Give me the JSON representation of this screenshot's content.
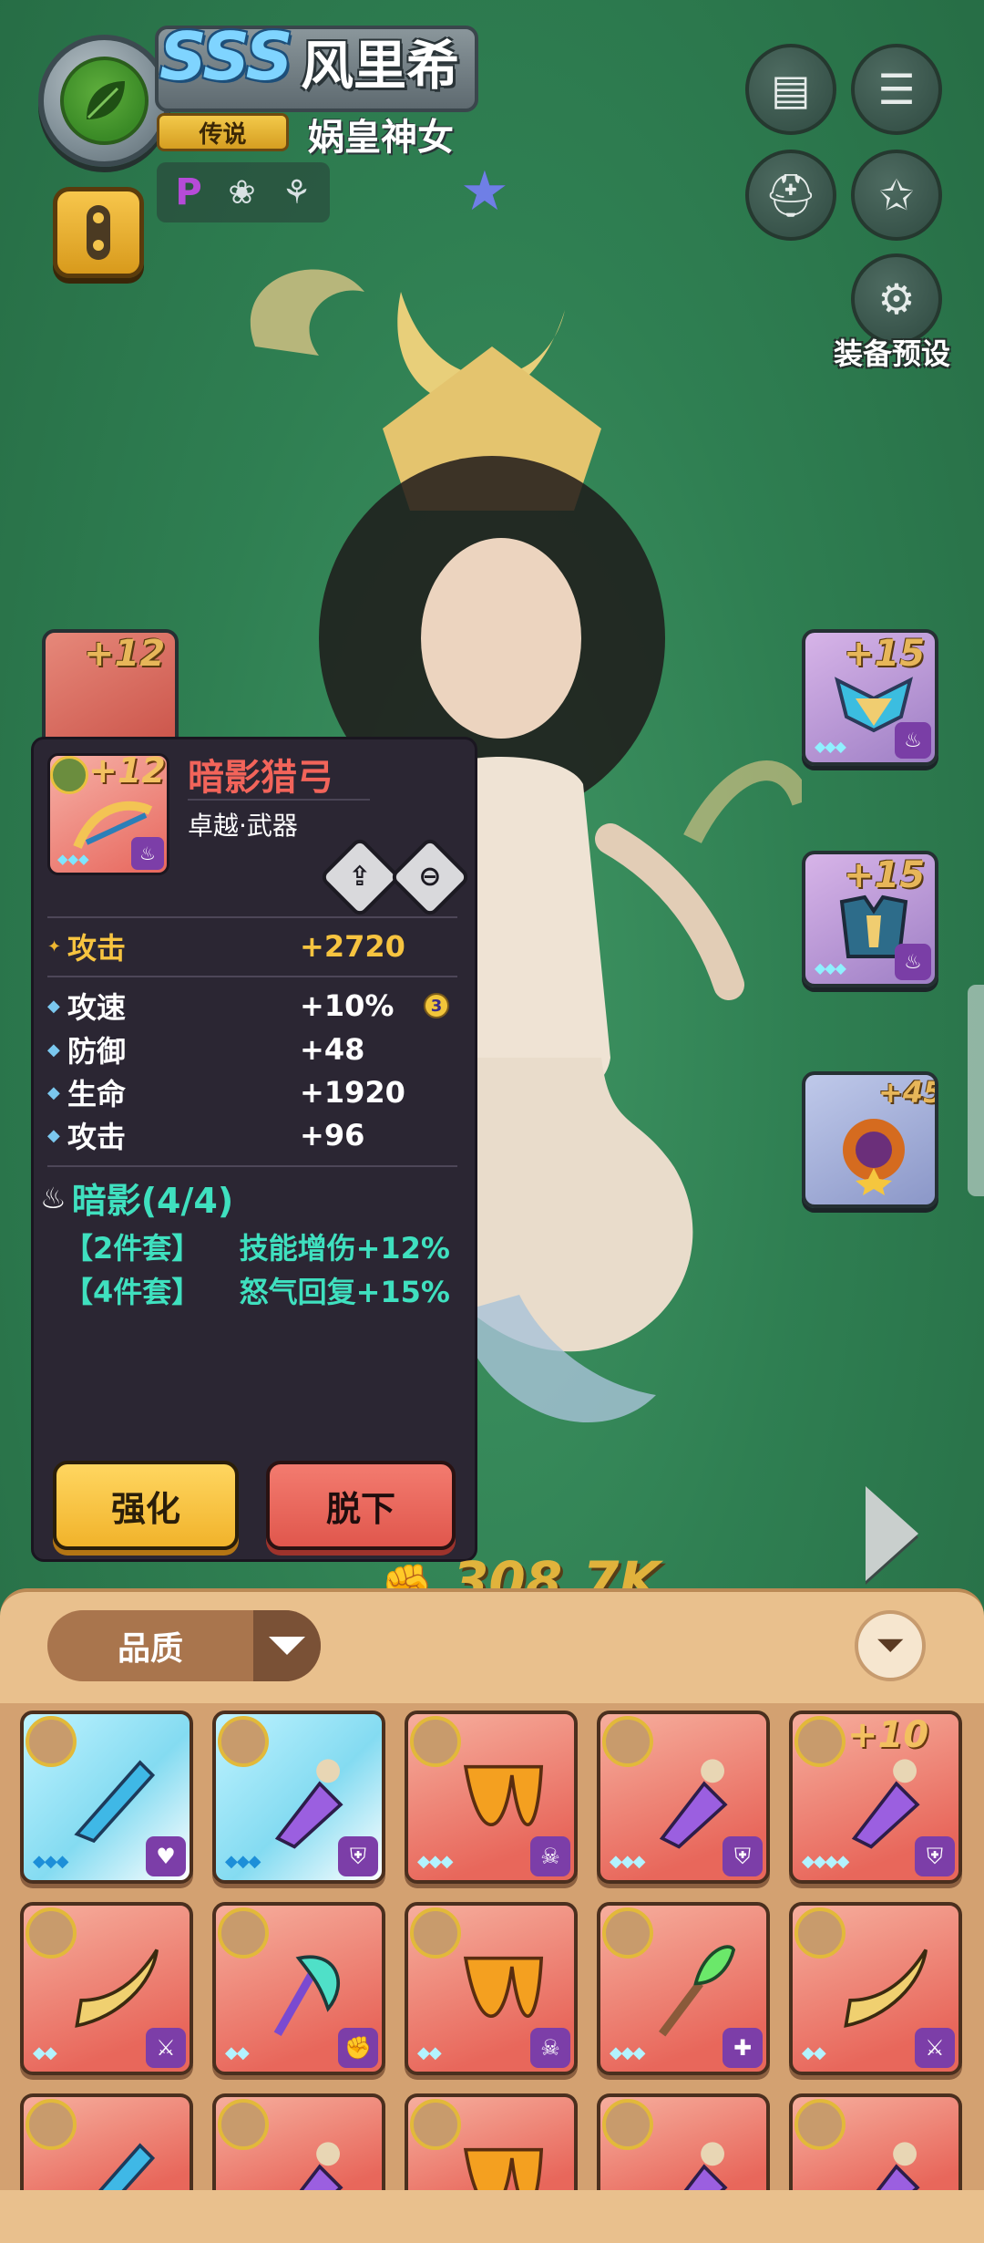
{
  "hero": {
    "grade": "SSS",
    "name": "风里希",
    "rarity": "传说",
    "title": "娲皇神女",
    "tags": [
      "P",
      "❀",
      "⚘"
    ]
  },
  "top_buttons": {
    "preset_label": "装备预设",
    "icons": [
      "book-icon",
      "list-icon",
      "helmet-swap-icon",
      "star-swap-icon",
      "armor-gear-icon"
    ]
  },
  "side_slots": {
    "left": [
      {
        "level": "+12"
      }
    ],
    "right": [
      {
        "level": "+15"
      },
      {
        "level": "+15"
      },
      {
        "level": "+45"
      }
    ]
  },
  "detail": {
    "item_level": "+12",
    "item_name": "暗影猎弓",
    "item_type": "卓越·武器",
    "main_stat": {
      "label": "攻击",
      "value": "+2720"
    },
    "sub_stats": [
      {
        "label": "攻速",
        "value": "+10%",
        "badge": "3"
      },
      {
        "label": "防御",
        "value": "+48"
      },
      {
        "label": "生命",
        "value": "+1920"
      },
      {
        "label": "攻击",
        "value": "+96"
      }
    ],
    "set_name": "暗影(4/4)",
    "set_bonuses": [
      {
        "pieces": "【2件套】",
        "effect": "技能增伤+12%"
      },
      {
        "pieces": "【4件套】",
        "effect": "怒气回复+15%"
      }
    ],
    "enhance_label": "强化",
    "remove_label": "脱下"
  },
  "power": "308.7K",
  "inventory": {
    "sort_label": "品质",
    "items": [
      {
        "bg": "cyan",
        "level": "",
        "gems": "◆◆◆",
        "icon": "♥"
      },
      {
        "bg": "cyan",
        "level": "",
        "gems": "◆◆◆",
        "icon": "⛨"
      },
      {
        "bg": "red",
        "level": "",
        "gems": "◆◆◆",
        "icon": "☠"
      },
      {
        "bg": "red",
        "level": "",
        "gems": "◆◆◆",
        "icon": "⛨"
      },
      {
        "bg": "red",
        "level": "+10",
        "gems": "◆◆◆◆",
        "icon": "⛨"
      },
      {
        "bg": "red",
        "level": "",
        "gems": "◆◆",
        "icon": "⚔"
      },
      {
        "bg": "red",
        "level": "",
        "gems": "◆◆",
        "icon": "✊"
      },
      {
        "bg": "red",
        "level": "",
        "gems": "◆◆",
        "icon": "☠"
      },
      {
        "bg": "red",
        "level": "",
        "gems": "◆◆◆",
        "icon": "✚"
      },
      {
        "bg": "red",
        "level": "",
        "gems": "◆◆",
        "icon": "⚔"
      },
      {
        "bg": "red",
        "level": "",
        "gems": "",
        "icon": ""
      },
      {
        "bg": "red",
        "level": "",
        "gems": "",
        "icon": ""
      },
      {
        "bg": "red",
        "level": "",
        "gems": "",
        "icon": ""
      },
      {
        "bg": "red",
        "level": "",
        "gems": "",
        "icon": ""
      },
      {
        "bg": "red",
        "level": "",
        "gems": "",
        "icon": ""
      }
    ]
  },
  "colors": {
    "background": "#2f7f52",
    "panel": "#2b2633",
    "item_name": "#f2645a",
    "main_stat": "#f7c440",
    "set_text": "#3fe0bf",
    "enhance": "#f1b32b",
    "remove": "#e0574d",
    "inventory": "#e9c08d"
  }
}
